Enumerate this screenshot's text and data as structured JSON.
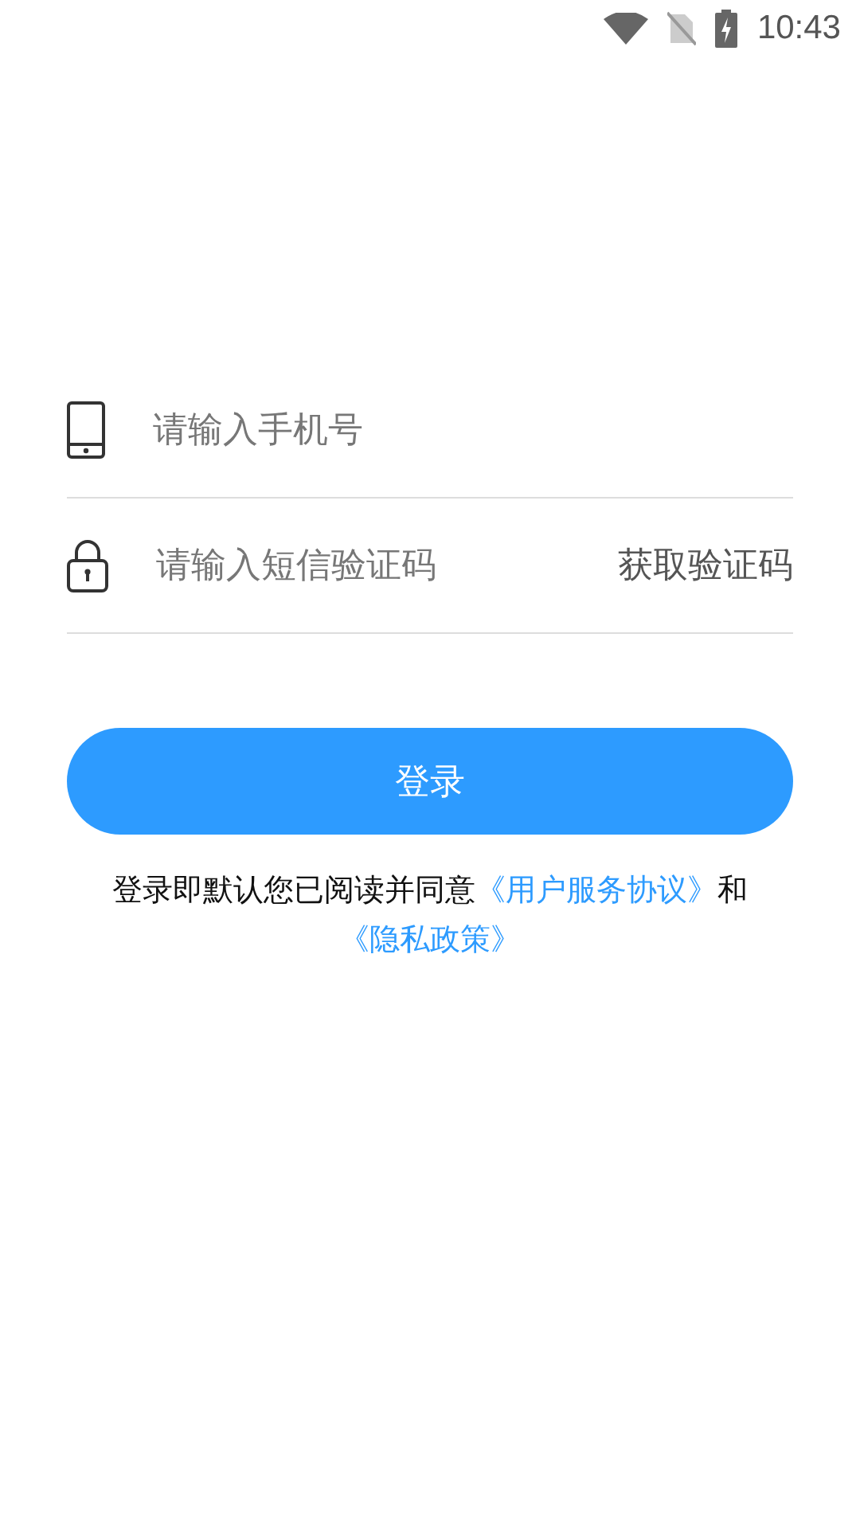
{
  "status_bar": {
    "time": "10:43"
  },
  "phone_field": {
    "placeholder": "请输入手机号"
  },
  "code_field": {
    "placeholder": "请输入短信验证码",
    "action": "获取验证码"
  },
  "login_button": {
    "label": "登录"
  },
  "agreement": {
    "text": "登录即默认您已阅读并同意",
    "links": [
      "《用户服务协议》",
      "《隐私政策》"
    ],
    "joiner": "和"
  }
}
